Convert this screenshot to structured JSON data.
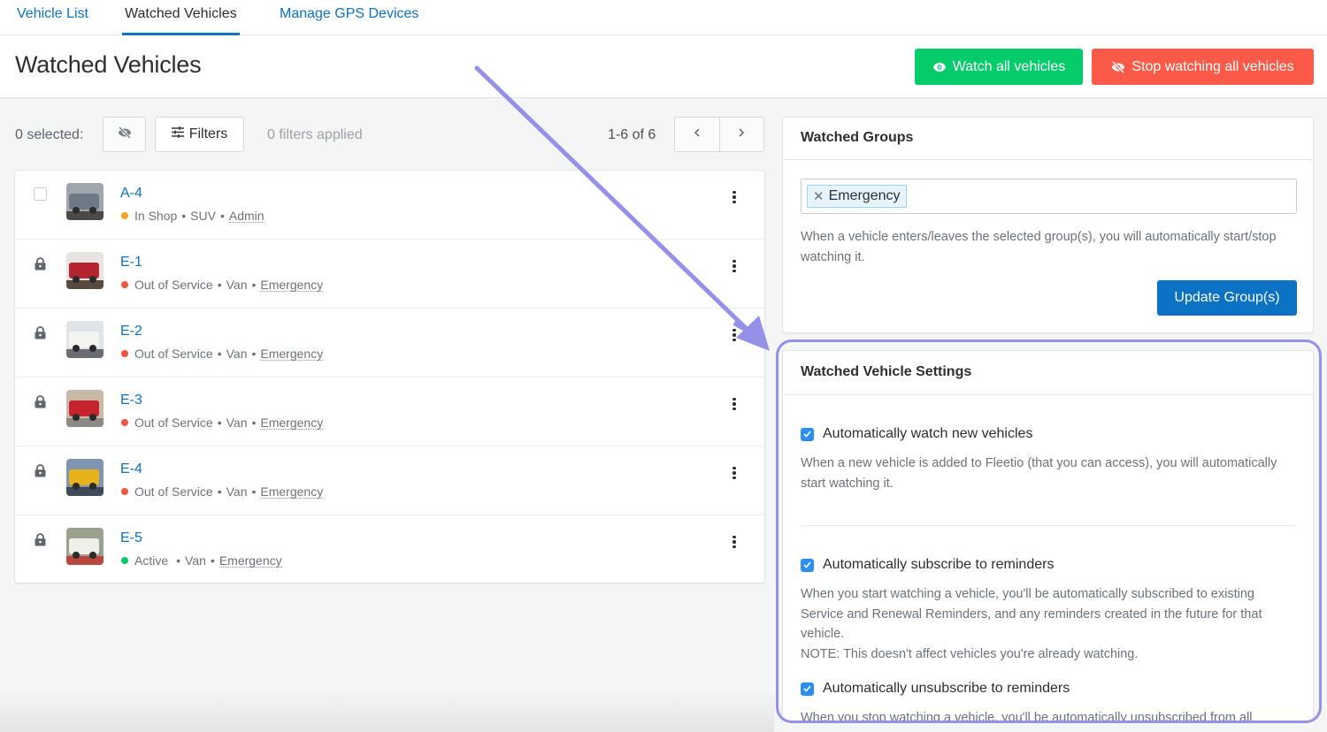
{
  "tabs": [
    {
      "label": "Vehicle List",
      "active": false
    },
    {
      "label": "Watched Vehicles",
      "active": true
    },
    {
      "label": "Manage GPS Devices",
      "active": false
    }
  ],
  "header": {
    "title": "Watched Vehicles",
    "watch_all_label": "Watch all vehicles",
    "stop_watching_all_label": "Stop watching all vehicles",
    "watch_icon": "eye-icon",
    "stop_icon": "eye-slash-icon"
  },
  "toolbar": {
    "selected_label": "0 selected:",
    "unwatch_icon": "eye-slash-icon",
    "filters_label": "Filters",
    "filters_icon": "sliders-icon",
    "filters_applied": "0 filters applied",
    "pagination": "1-6 of 6",
    "prev_icon": "chevron-left-icon",
    "next_icon": "chevron-right-icon"
  },
  "vehicles": [
    {
      "name": "A-4",
      "status": "In Shop",
      "status_color": "#f7a21b",
      "type": "SUV",
      "group": "Admin",
      "locked": false,
      "thumb_colors": [
        "#9fa7ad",
        "#6d7a86",
        "#4d4a45"
      ]
    },
    {
      "name": "E-1",
      "status": "Out of Service",
      "status_color": "#f5533d",
      "type": "Van",
      "group": "Emergency",
      "locked": true,
      "thumb_colors": [
        "#e8e4e2",
        "#b3262f",
        "#5a4a3d"
      ]
    },
    {
      "name": "E-2",
      "status": "Out of Service",
      "status_color": "#f5533d",
      "type": "Van",
      "group": "Emergency",
      "locked": true,
      "thumb_colors": [
        "#dfe4e8",
        "#f4f4f2",
        "#6a6e72"
      ]
    },
    {
      "name": "E-3",
      "status": "Out of Service",
      "status_color": "#f5533d",
      "type": "Van",
      "group": "Emergency",
      "locked": true,
      "thumb_colors": [
        "#c9b9a8",
        "#c5222b",
        "#8b8b84"
      ]
    },
    {
      "name": "E-4",
      "status": "Out of Service",
      "status_color": "#f5533d",
      "type": "Van",
      "group": "Emergency",
      "locked": true,
      "thumb_colors": [
        "#7f95b1",
        "#e8b21c",
        "#3e4a5a"
      ]
    },
    {
      "name": "E-5",
      "status": "Active",
      "status_color": "#05cc6b",
      "type": "Van",
      "group": "Emergency",
      "locked": true,
      "thumb_colors": [
        "#9aa28f",
        "#f1efe9",
        "#b9473e"
      ]
    }
  ],
  "watched_groups": {
    "title": "Watched Groups",
    "selected": [
      "Emergency"
    ],
    "help": "When a vehicle enters/leaves the selected group(s), you will automatically start/stop watching it.",
    "update_label": "Update Group(s)"
  },
  "settings": {
    "title": "Watched Vehicle Settings",
    "items": [
      {
        "label": "Automatically watch new vehicles",
        "checked": true,
        "description": "When a new vehicle is added to Fleetio (that you can access), you will automatically start watching it."
      },
      {
        "label": "Automatically subscribe to reminders",
        "checked": true,
        "description": "When you start watching a vehicle, you'll be automatically subscribed to existing Service and Renewal Reminders, and any reminders created in the future for that vehicle.",
        "note": "NOTE: This doesn't affect vehicles you're already watching."
      },
      {
        "label": "Automatically unsubscribe to reminders",
        "checked": true,
        "description": "When you stop watching a vehicle, you'll be automatically unsubscribed from all"
      }
    ]
  },
  "colors": {
    "primary": "#0b72c4",
    "success": "#05cc6b",
    "danger": "#fb5a48",
    "annotation": "#9590e8"
  }
}
